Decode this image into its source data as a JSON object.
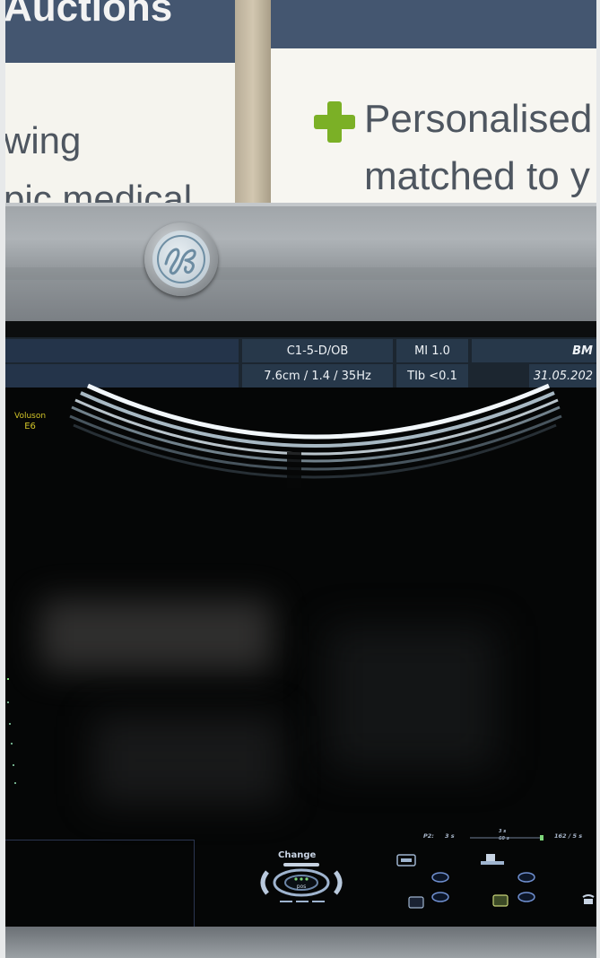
{
  "background": {
    "left_banner": {
      "heading": "Auctions",
      "line1": "wing",
      "line2": "pic medical"
    },
    "right_banner": {
      "line1": "Personalised",
      "line2": "matched to y"
    }
  },
  "bezel": {
    "logo": "ge-logo"
  },
  "screen": {
    "info_bar": {
      "probe": "C1-5-D/OB",
      "depth_freq": "7.6cm / 1.4 / 35Hz",
      "mi": "MI  1.0",
      "tib": "TIb <0.1",
      "mode": "BM",
      "date": "31.05.202"
    },
    "device": {
      "brand": "Voluson",
      "model": "E6"
    },
    "controls": {
      "change_label": "Change",
      "dial_hint": "pos",
      "p2_label": "P2:",
      "p2_value": "3 s",
      "p2_slider_value": "3 s",
      "p2_slider_sub": "60 s",
      "p2_right": "162 / 5 s"
    },
    "colors": {
      "info_cell": "#27384a",
      "probe_label": "#d2c428",
      "screen_bg": "#050606"
    }
  }
}
